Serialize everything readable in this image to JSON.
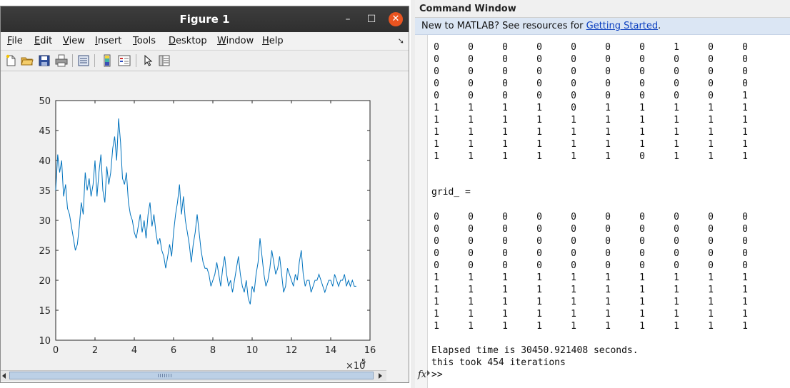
{
  "figure": {
    "title": "Figure 1",
    "menus": [
      {
        "u": "F",
        "rest": "ile"
      },
      {
        "u": "E",
        "rest": "dit"
      },
      {
        "u": "V",
        "rest": "iew"
      },
      {
        "u": "I",
        "rest": "nsert"
      },
      {
        "u": "T",
        "rest": "ools"
      },
      {
        "u": "D",
        "rest": "esktop"
      },
      {
        "u": "W",
        "rest": "indow"
      },
      {
        "u": "H",
        "rest": "elp"
      }
    ],
    "toolbar_icons": [
      "new-figure-icon",
      "open-file-icon",
      "save-icon",
      "print-icon",
      "print-preview-icon",
      "insert-colorbar-icon",
      "insert-legend-icon",
      "edit-plot-icon",
      "property-inspector-icon"
    ],
    "close_glyph": "✕",
    "minimize_glyph": "–",
    "maximize_glyph": "☐",
    "colors": {
      "line": "#0072bd",
      "close": "#e95420"
    }
  },
  "chart_data": {
    "type": "line",
    "xlim": [
      0,
      16
    ],
    "ylim": [
      10,
      50
    ],
    "x_ticks": [
      0,
      2,
      4,
      6,
      8,
      10,
      12,
      14,
      16
    ],
    "y_ticks": [
      10,
      15,
      20,
      25,
      30,
      35,
      40,
      45,
      50
    ],
    "x_exponent_label": "×10",
    "x_exponent_power": "5",
    "grid": false,
    "series": [
      {
        "color": "#0072bd",
        "x_step": 0.1,
        "values": [
          35,
          41,
          38,
          40,
          34,
          36,
          32,
          31,
          29,
          27,
          25,
          26,
          29,
          33,
          31,
          38,
          35,
          37,
          34,
          36,
          40,
          34,
          38,
          41,
          35,
          33,
          39,
          36,
          38,
          42,
          44,
          40,
          47,
          43,
          37,
          36,
          38,
          33,
          31,
          30,
          28,
          27,
          29,
          31,
          28,
          30,
          27,
          31,
          33,
          29,
          31,
          28,
          26,
          27,
          25,
          24,
          22,
          24,
          26,
          24,
          28,
          31,
          33,
          36,
          31,
          34,
          30,
          28,
          26,
          23,
          26,
          28,
          31,
          28,
          25,
          23,
          22,
          22,
          21,
          19,
          20,
          21,
          23,
          21,
          19,
          22,
          24,
          21,
          19,
          20,
          18,
          20,
          22,
          24,
          21,
          19,
          18,
          20,
          17,
          16,
          19,
          18,
          21,
          23,
          27,
          24,
          21,
          19,
          20,
          22,
          25,
          23,
          21,
          22,
          24,
          21,
          18,
          19,
          22,
          21,
          20,
          19,
          21,
          20,
          23,
          25,
          21,
          19,
          20,
          20,
          18,
          19,
          20,
          20,
          21,
          20,
          19,
          18,
          19,
          20,
          20,
          19,
          21,
          20,
          19,
          20,
          20,
          21,
          19,
          20,
          19,
          20,
          19,
          19
        ]
      }
    ]
  },
  "command_window": {
    "title": "Command Window",
    "banner_text": "New to MATLAB? See resources for ",
    "banner_link": "Getting Started",
    "banner_after": ".",
    "matrix1": [
      [
        "0",
        "0",
        "0",
        "0",
        "0",
        "0",
        "0",
        "1",
        "0",
        "0"
      ],
      [
        "0",
        "0",
        "0",
        "0",
        "0",
        "0",
        "0",
        "0",
        "0",
        "0"
      ],
      [
        "0",
        "0",
        "0",
        "0",
        "0",
        "0",
        "0",
        "0",
        "0",
        "0"
      ],
      [
        "0",
        "0",
        "0",
        "0",
        "0",
        "0",
        "0",
        "0",
        "0",
        "0"
      ],
      [
        "0",
        "0",
        "0",
        "0",
        "0",
        "0",
        "0",
        "0",
        "0",
        "1"
      ],
      [
        "1",
        "1",
        "1",
        "1",
        "0",
        "1",
        "1",
        "1",
        "1",
        "1"
      ],
      [
        "1",
        "1",
        "1",
        "1",
        "1",
        "1",
        "1",
        "1",
        "1",
        "1"
      ],
      [
        "1",
        "1",
        "1",
        "1",
        "1",
        "1",
        "1",
        "1",
        "1",
        "1"
      ],
      [
        "1",
        "1",
        "1",
        "1",
        "1",
        "1",
        "1",
        "1",
        "1",
        "1"
      ],
      [
        "1",
        "1",
        "1",
        "1",
        "1",
        "1",
        "0",
        "1",
        "1",
        "1"
      ]
    ],
    "grid_label": "grid_ =",
    "matrix2": [
      [
        "0",
        "0",
        "0",
        "0",
        "0",
        "0",
        "0",
        "0",
        "0",
        "0"
      ],
      [
        "0",
        "0",
        "0",
        "0",
        "0",
        "0",
        "0",
        "0",
        "0",
        "0"
      ],
      [
        "0",
        "0",
        "0",
        "0",
        "0",
        "0",
        "0",
        "0",
        "0",
        "0"
      ],
      [
        "0",
        "0",
        "0",
        "0",
        "0",
        "0",
        "0",
        "0",
        "0",
        "0"
      ],
      [
        "0",
        "0",
        "0",
        "0",
        "0",
        "0",
        "0",
        "0",
        "0",
        "0"
      ],
      [
        "1",
        "1",
        "1",
        "1",
        "1",
        "1",
        "1",
        "1",
        "1",
        "1"
      ],
      [
        "1",
        "1",
        "1",
        "1",
        "1",
        "1",
        "1",
        "1",
        "1",
        "1"
      ],
      [
        "1",
        "1",
        "1",
        "1",
        "1",
        "1",
        "1",
        "1",
        "1",
        "1"
      ],
      [
        "1",
        "1",
        "1",
        "1",
        "1",
        "1",
        "1",
        "1",
        "1",
        "1"
      ],
      [
        "1",
        "1",
        "1",
        "1",
        "1",
        "1",
        "1",
        "1",
        "1",
        "1"
      ]
    ],
    "elapsed_text": "Elapsed time is 30450.921408 seconds.",
    "iterations_text": "this took 454 iterations",
    "fx_label": "fx",
    "prompt": ">>"
  }
}
